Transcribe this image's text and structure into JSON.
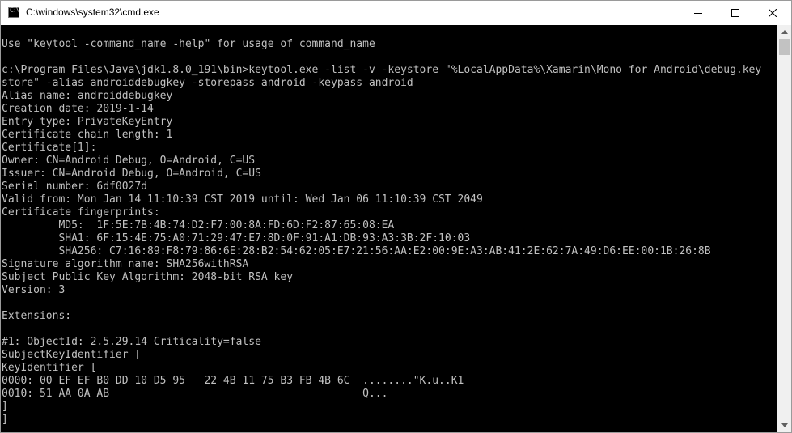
{
  "window": {
    "title": "C:\\windows\\system32\\cmd.exe"
  },
  "console": {
    "lines": [
      "",
      "Use \"keytool -command_name -help\" for usage of command_name",
      "",
      "c:\\Program Files\\Java\\jdk1.8.0_191\\bin>keytool.exe -list -v -keystore \"%LocalAppData%\\Xamarin\\Mono for Android\\debug.key",
      "store\" -alias androiddebugkey -storepass android -keypass android",
      "Alias name: androiddebugkey",
      "Creation date: 2019-1-14",
      "Entry type: PrivateKeyEntry",
      "Certificate chain length: 1",
      "Certificate[1]:",
      "Owner: CN=Android Debug, O=Android, C=US",
      "Issuer: CN=Android Debug, O=Android, C=US",
      "Serial number: 6df0027d",
      "Valid from: Mon Jan 14 11:10:39 CST 2019 until: Wed Jan 06 11:10:39 CST 2049",
      "Certificate fingerprints:",
      "         MD5:  1F:5E:7B:4B:74:D2:F7:00:8A:FD:6D:F2:87:65:08:EA",
      "         SHA1: 6F:15:4E:75:A0:71:29:47:E7:8D:0F:91:A1:DB:93:A3:3B:2F:10:03",
      "         SHA256: C7:16:89:F8:79:86:6E:28:B2:54:62:05:E7:21:56:AA:E2:00:9E:A3:AB:41:2E:62:7A:49:D6:EE:00:1B:26:8B",
      "Signature algorithm name: SHA256withRSA",
      "Subject Public Key Algorithm: 2048-bit RSA key",
      "Version: 3",
      "",
      "Extensions:",
      "",
      "#1: ObjectId: 2.5.29.14 Criticality=false",
      "SubjectKeyIdentifier [",
      "KeyIdentifier [",
      "0000: 00 EF EF B0 DD 10 D5 95   22 4B 11 75 B3 FB 4B 6C  ........\"K.u..K1",
      "0010: 51 AA 0A AB                                        Q...",
      "]",
      "]"
    ]
  },
  "colors": {
    "console_bg": "#000000",
    "console_fg": "#c0c0c0",
    "titlebar_bg": "#ffffff",
    "scrollbar_bg": "#f0f0f0"
  },
  "icons": {
    "app": "cmd-app-icon",
    "minimize": "minimize-icon",
    "maximize": "maximize-icon",
    "close": "close-icon"
  }
}
